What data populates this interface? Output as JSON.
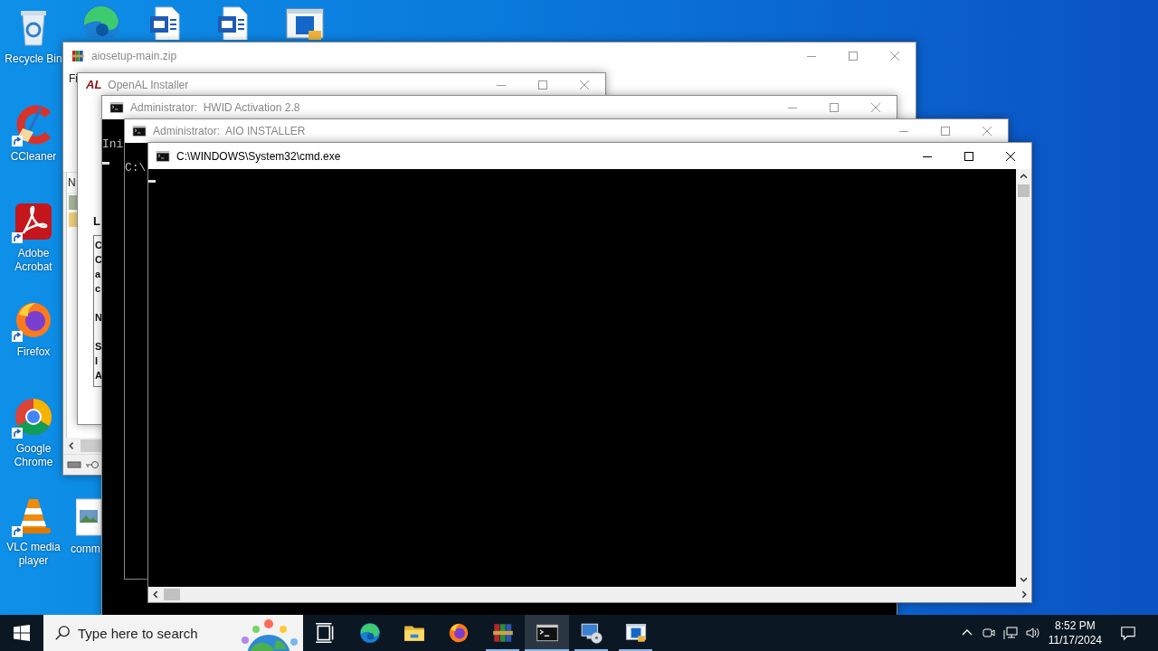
{
  "desktop_icons": [
    {
      "kind": "recycle-bin",
      "label": "Recycle Bin",
      "shortcut": false
    },
    {
      "kind": "edge",
      "shortcut": false
    },
    {
      "kind": "document",
      "shortcut": false
    },
    {
      "kind": "document",
      "shortcut": false
    },
    {
      "kind": "window",
      "shortcut": false
    },
    {
      "kind": "cleaner",
      "label": "CCleaner",
      "shortcut": true
    },
    {
      "kind": "pdf",
      "label": "Adobe Acrobat",
      "shortcut": true
    },
    {
      "kind": "firefox",
      "label": "Firefox",
      "shortcut": true
    },
    {
      "kind": "chrome",
      "label": "Google Chrome",
      "shortcut": true
    },
    {
      "kind": "cone",
      "label": "VLC media player",
      "shortcut": true
    },
    {
      "kind": "image-file",
      "label": "comm",
      "shortcut": false
    }
  ],
  "windows": [
    {
      "kind": "archive",
      "title": "aiosetup-main.zip",
      "active": false,
      "menu": "Fi",
      "column_1": "N"
    },
    {
      "kind": "installer",
      "logo": "AL",
      "title": "OpenAL Installer",
      "active": false,
      "heading": "L",
      "text_lines": [
        "C",
        "C",
        "a",
        "c",
        "N",
        "S",
        "I",
        "A"
      ]
    },
    {
      "kind": "console",
      "title": "Administrator:  HWID Activation 2.8",
      "active": false,
      "lines": [
        "Ini"
      ],
      "cursor": true
    },
    {
      "kind": "console",
      "title": "Administrator:  AIO INSTALLER",
      "active": false,
      "lines": [
        "C:\\"
      ],
      "cursor": false
    },
    {
      "kind": "console",
      "title": "C:\\WINDOWS\\System32\\cmd.exe",
      "active": true,
      "cursor": true
    }
  ],
  "taskbar": {
    "search": {
      "placeholder": "Type here to search"
    },
    "apps": [
      {
        "kind": "task-view",
        "running": false,
        "selected": false
      },
      {
        "kind": "edge",
        "running": false,
        "selected": false
      },
      {
        "kind": "explorer",
        "running": false,
        "selected": false
      },
      {
        "kind": "firefox",
        "running": false,
        "selected": false
      },
      {
        "kind": "archive",
        "running": true,
        "selected": false
      },
      {
        "kind": "console",
        "running": true,
        "selected": true
      },
      {
        "kind": "setup-disc",
        "running": true,
        "selected": false
      },
      {
        "kind": "window",
        "running": true,
        "selected": false
      }
    ],
    "clock": {
      "time": "8:52 PM",
      "date": "11/17/2024"
    }
  }
}
